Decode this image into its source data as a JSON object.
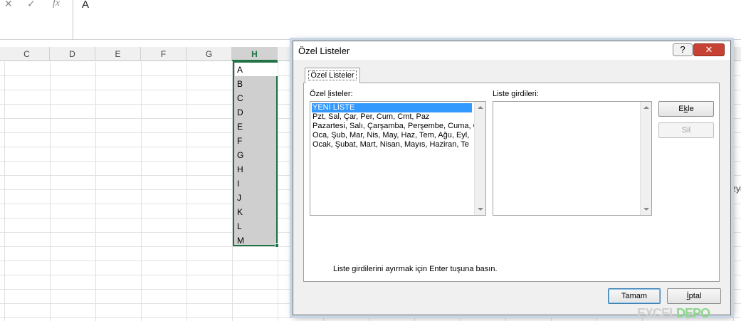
{
  "formula_bar": {
    "cancel_icon": "✕",
    "enter_icon": "✓",
    "function_icon": "fx",
    "content": "A"
  },
  "columns": [
    "C",
    "D",
    "E",
    "F",
    "G",
    "H"
  ],
  "active_column": "H",
  "selected_cells": [
    "A",
    "B",
    "C",
    "D",
    "E",
    "F",
    "G",
    "H",
    "I",
    "J",
    "K",
    "L",
    "M"
  ],
  "dialog": {
    "title": "Özel Listeler",
    "help_label": "?",
    "close_label": "✕",
    "tab_label": "Özel Listeler",
    "lists_label_pre": "Özel ",
    "lists_label_accel": "l",
    "lists_label_post": "isteler:",
    "entries_label_pre": "Liste ",
    "entries_label_accel": "g",
    "entries_label_post": "irdileri:",
    "lists": [
      "YENİ LİSTE",
      "Pzt, Sal, Çar, Per, Cum, Cmt, Paz",
      "Pazartesi, Salı, Çarşamba, Perşembe, Cuma, C",
      "Oca, Şub, Mar, Nis, May, Haz, Tem, Ağu, Eyl,",
      "Ocak, Şubat, Mart, Nisan, Mayıs, Haziran, Te"
    ],
    "selected_list_index": 0,
    "add_button_pre": "E",
    "add_button_accel": "k",
    "add_button_post": "le",
    "delete_button": "Sil",
    "hint": "Liste girdilerini ayırmak için Enter tuşuna basın.",
    "ok_button": "Tamam",
    "cancel_button_accel": "İ",
    "cancel_button_post": "ptal"
  },
  "side_text": "zyi",
  "watermark": {
    "part1": "EXCEL",
    "part2": "DEPO"
  }
}
